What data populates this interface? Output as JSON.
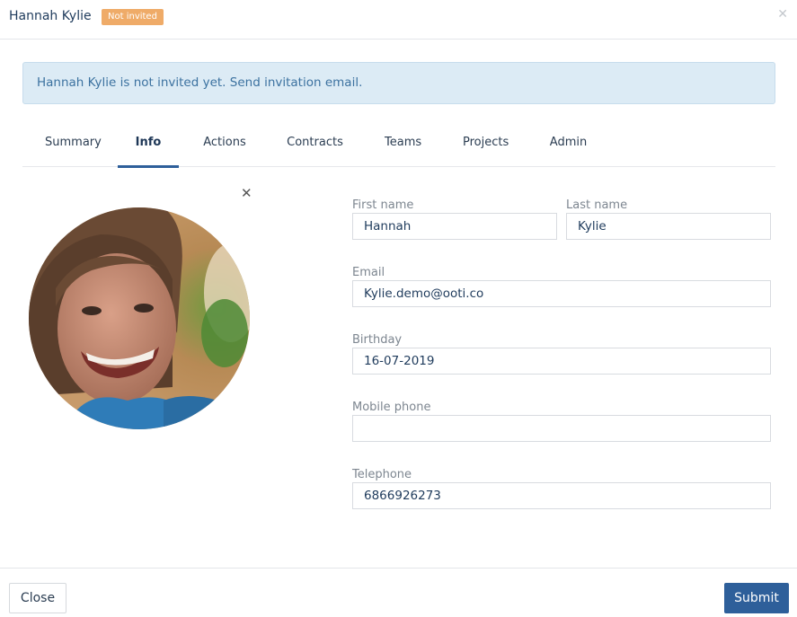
{
  "header": {
    "title": "Hannah Kylie",
    "badge": "Not invited",
    "close_icon": "close-icon"
  },
  "alert": {
    "text": "Hannah Kylie is not invited yet.",
    "link": "Send invitation email."
  },
  "tabs": [
    {
      "label": "Summary",
      "active": false
    },
    {
      "label": "Info",
      "active": true
    },
    {
      "label": "Actions",
      "active": false
    },
    {
      "label": "Contracts",
      "active": false
    },
    {
      "label": "Teams",
      "active": false
    },
    {
      "label": "Projects",
      "active": false
    },
    {
      "label": "Admin",
      "active": false
    }
  ],
  "avatar": {
    "remove_icon": "close-icon",
    "description": "profile-photo"
  },
  "form": {
    "first_name": {
      "label": "First name",
      "value": "Hannah"
    },
    "last_name": {
      "label": "Last name",
      "value": "Kylie"
    },
    "email": {
      "label": "Email",
      "value": "Kylie.demo@ooti.co"
    },
    "birthday": {
      "label": "Birthday",
      "value": "16-07-2019"
    },
    "mobile_phone": {
      "label": "Mobile phone",
      "value": ""
    },
    "telephone": {
      "label": "Telephone",
      "value": "6866926273"
    }
  },
  "footer": {
    "close_label": "Close",
    "submit_label": "Submit"
  },
  "colors": {
    "badge": "#efab68",
    "alert_bg": "#dcebf5",
    "primary": "#2e5f9a"
  }
}
